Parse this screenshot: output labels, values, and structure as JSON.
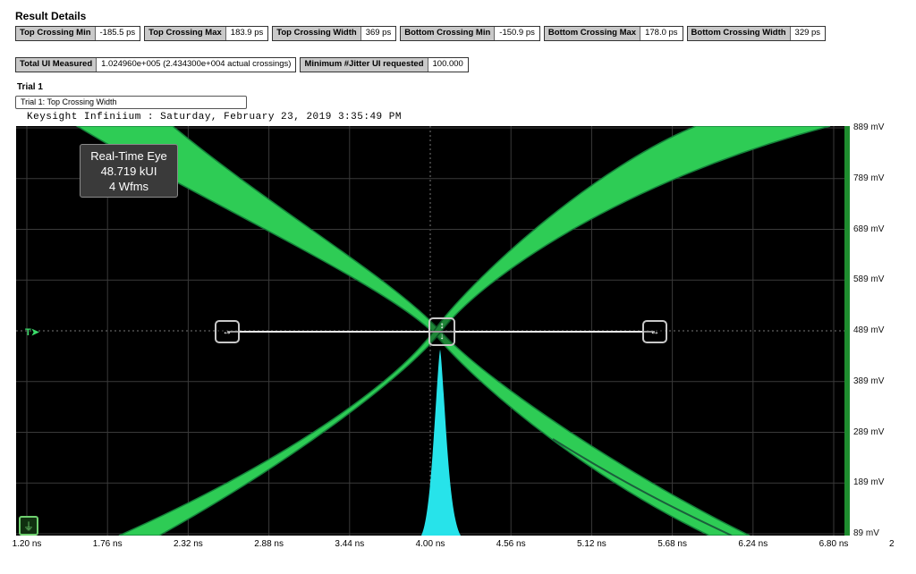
{
  "header": {
    "title": "Result Details"
  },
  "metrics_row1": [
    {
      "label": "Top Crossing Min",
      "value": "-185.5 ps"
    },
    {
      "label": "Top Crossing Max",
      "value": "183.9 ps"
    },
    {
      "label": "Top Crossing Width",
      "value": "369 ps"
    },
    {
      "label": "Bottom Crossing Min",
      "value": "-150.9 ps"
    },
    {
      "label": "Bottom Crossing Max",
      "value": "178.0 ps"
    },
    {
      "label": "Bottom Crossing Width",
      "value": "329 ps"
    }
  ],
  "metrics_row2": [
    {
      "label": "Total UI Measured",
      "value": "1.024960e+005 (2.434300e+004 actual crossings)"
    },
    {
      "label": "Minimum #Jitter UI requested",
      "value": "100.000"
    }
  ],
  "trial": {
    "heading": "Trial 1",
    "selector": "Trial 1: Top Crossing Width"
  },
  "scope": {
    "banner": "Keysight Infiniium : Saturday, February 23, 2019 3:35:49 PM",
    "info": {
      "mode": "Real-Time Eye",
      "ui_count": "48.719 kUI",
      "waveforms": "4 Wfms"
    },
    "trigger_marker": "T",
    "y_axis_labels": [
      "889 mV",
      "789 mV",
      "689 mV",
      "589 mV",
      "489 mV",
      "389 mV",
      "289 mV",
      "189 mV",
      "89 mV"
    ],
    "x_axis_labels": [
      "1.20 ns",
      "1.76 ns",
      "2.32 ns",
      "2.88 ns",
      "3.44 ns",
      "4.00 ns",
      "4.56 ns",
      "5.12 ns",
      "5.68 ns",
      "6.24 ns",
      "6.80 ns"
    ],
    "x_axis_extra": "2",
    "colors": {
      "eye": "#2ecc55",
      "eye_edge": "#14813a",
      "histogram": "#27e3ea",
      "grid": "#3a3a3a",
      "cursor": "#e8e8e8"
    }
  }
}
